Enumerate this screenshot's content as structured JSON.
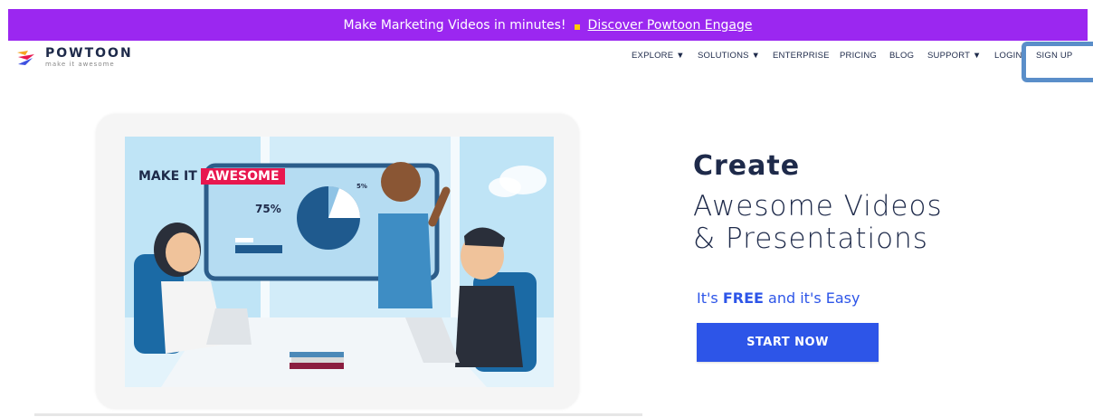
{
  "banner": {
    "text": "Make Marketing Videos in minutes!",
    "link": "Discover Powtoon Engage"
  },
  "logo": {
    "name": "POWTOON",
    "tagline": "make it awesome"
  },
  "nav": {
    "explore": "EXPLORE ▼",
    "solutions": "SOLUTIONS ▼",
    "enterprise": "ENTERPRISE",
    "pricing": "PRICING",
    "blog": "BLOG",
    "support": "SUPPORT ▼",
    "login": "LOGIN",
    "signup": "SIGN UP"
  },
  "illustration": {
    "banner_prefix": "MAKE IT",
    "banner_highlight": "AWESOME",
    "pie_big_label": "75%",
    "pie_small_label": "5%"
  },
  "hero": {
    "title": "Create",
    "subtitle_line1": "Awesome Videos",
    "subtitle_line2": "& Presentations",
    "free_prefix": "It's",
    "free_bold": "FREE",
    "free_suffix": "and it's Easy",
    "cta": "START NOW"
  },
  "colors": {
    "banner_bg": "#9b27f0",
    "accent_blue": "#2d55e8",
    "navy": "#1e2a4a",
    "highlight_box": "#5a8ec9",
    "awesome_red": "#e8174f"
  }
}
